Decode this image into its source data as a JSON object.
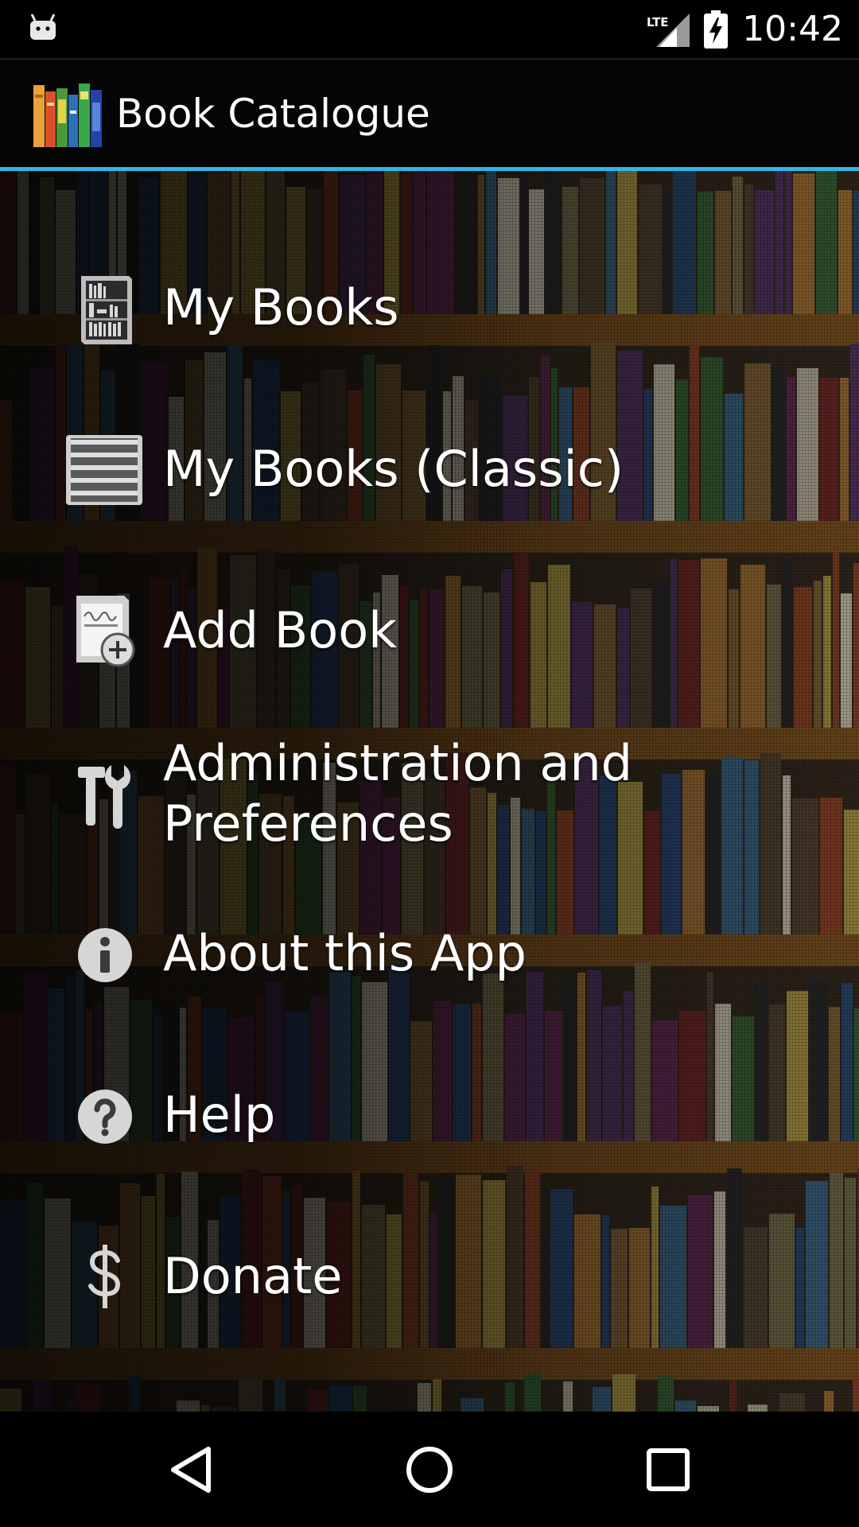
{
  "status_bar": {
    "time": "10:42",
    "network": "LTE",
    "notification_icon": "android-icon",
    "battery_icon": "battery-charging-icon"
  },
  "action_bar": {
    "title": "Book Catalogue",
    "logo_icon": "books-logo-icon",
    "accent_color": "#33b5e5"
  },
  "menu": {
    "items": [
      {
        "label": "My Books",
        "icon": "bookshelf-icon"
      },
      {
        "label": "My Books (Classic)",
        "icon": "list-icon"
      },
      {
        "label": "Add Book",
        "icon": "add-book-icon"
      },
      {
        "label": "Administration and Preferences",
        "icon": "tools-icon"
      },
      {
        "label": "About this App",
        "icon": "info-icon"
      },
      {
        "label": "Help",
        "icon": "help-icon"
      },
      {
        "label": "Donate",
        "icon": "dollar-icon"
      }
    ]
  },
  "nav_bar": {
    "back": "back-icon",
    "home": "home-icon",
    "recents": "recents-icon"
  }
}
